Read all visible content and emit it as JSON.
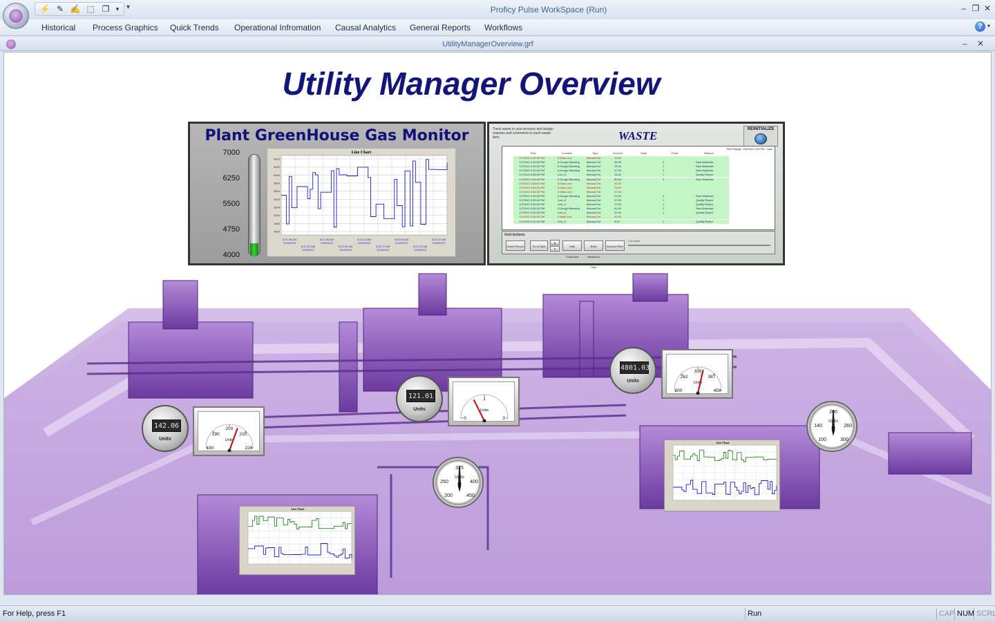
{
  "window": {
    "title": "Proficy Pulse WorkSpace (Run)",
    "minimize": "‒",
    "restore": "❐",
    "close": "✕"
  },
  "quick_access": {
    "icons": [
      "run-icon",
      "edit-icon",
      "draw-icon",
      "select-icon",
      "window-icon"
    ],
    "glyphs": [
      "⚡",
      "✎",
      "✍",
      "⬚",
      "❐"
    ],
    "dropdown": "▾",
    "customize": "▾"
  },
  "menu": {
    "items": [
      "Historical",
      "Process Graphics",
      "Quick Trends",
      "Operational Infromation",
      "Causal Analytics",
      "General Reports",
      "Workflows"
    ],
    "help": "?",
    "help_dropdown": "▾"
  },
  "document": {
    "title": "UtilityManagerOverview.grf",
    "minimize": "‒",
    "close": "✕"
  },
  "canvas": {
    "title": "Utility Manager Overview"
  },
  "ghg_monitor": {
    "title": "Plant GreenHouse Gas Monitor",
    "scale_labels": [
      "7000",
      "6250",
      "5500",
      "4750",
      "4000"
    ],
    "scale_min": 4000,
    "scale_max": 7000,
    "level_value": 4400,
    "fill_color": "#3ad43a",
    "chart_title": "Line Chart",
    "chart_y_labels": [
      "6400",
      "6200",
      "6000",
      "5800",
      "5600",
      "5400",
      "5200",
      "5000",
      "4800",
      "4600"
    ],
    "chart_x_labels": [
      "6:21:45 AM",
      "6:21:58 AM",
      "6:22:11 AM",
      "6:22:24 AM",
      "6:22:37 AM"
    ],
    "chart_x_labels2": [
      "6:21:51 AM",
      "6:22:04 AM",
      "6:22:17 AM",
      "6:22:31 AM"
    ],
    "chart_date": "3/16/2015",
    "series_color": "#1a1ad6"
  },
  "waste": {
    "title": "WASTE",
    "description": "Track waste in your process and assign reasons and comments to each waste item.",
    "reinitialize_label": "REINITIALIZE",
    "time_range": "Time Range:  1/6/2010 4:25 PM - Now",
    "columns": [
      "Time",
      "Location",
      "Type",
      "Amount",
      "Units",
      "Fault",
      "Reason"
    ],
    "rows": [
      {
        "time": "1/7/2010 4:25:00 PM",
        "location": "6 Main Line",
        "type": "Manual Ent",
        "amount": "10.00",
        "units": "",
        "fault": "",
        "reason": "",
        "red": true
      },
      {
        "time": "1/7/2010 4:20:00 PM",
        "location": "6 Dough Blending",
        "type": "Manual Ent",
        "amount": "39.00",
        "units": "",
        "fault": "2",
        "reason": "Raw Materials",
        "red": false
      },
      {
        "time": "1/7/2010 4:15:00 PM",
        "location": "6 Dough Blending",
        "type": "Manual Ent",
        "amount": "13.00",
        "units": "",
        "fault": "2",
        "reason": "Raw Materials",
        "red": false
      },
      {
        "time": "1/7/2010 4:10:00 PM",
        "location": "6 Dough Blending",
        "type": "Manual Ent",
        "amount": "47.00",
        "units": "",
        "fault": "2",
        "reason": "Raw Materials",
        "red": false
      },
      {
        "time": "1/7/2010 4:05:00 PM",
        "location": "Line_6",
        "type": "Manual Ent",
        "amount": "14.00",
        "units": "",
        "fault": "1",
        "reason": "Quality Reject",
        "red": false
      },
      {
        "time": "1/7/2010 4:00:00 PM",
        "location": "6 Dough Blending",
        "type": "Manual Ent",
        "amount": "59.00",
        "units": "",
        "fault": "2",
        "reason": "Raw Materials",
        "red": false
      },
      {
        "time": "1/7/2010 3:55:00 PM",
        "location": "6 Main Line",
        "type": "Manual Ent",
        "amount": "42.00",
        "units": "",
        "fault": "",
        "reason": "",
        "red": true
      },
      {
        "time": "1/7/2010 3:50:00 PM",
        "location": "6 Main Line",
        "type": "Manual Ent",
        "amount": "73.00",
        "units": "",
        "fault": "",
        "reason": "",
        "red": true
      },
      {
        "time": "1/7/2010 3:45:00 PM",
        "location": "6 Main Line",
        "type": "Manual Ent",
        "amount": "47.00",
        "units": "",
        "fault": "",
        "reason": "",
        "red": true
      },
      {
        "time": "1/7/2010 3:40:00 PM",
        "location": "6 Dough Blending",
        "type": "Manual Ent",
        "amount": "21.00",
        "units": "",
        "fault": "2",
        "reason": "Raw Materials",
        "red": false
      },
      {
        "time": "1/7/2010 3:35:00 PM",
        "location": "Line_6",
        "type": "Manual Ent",
        "amount": "47.00",
        "units": "",
        "fault": "1",
        "reason": "Quality Reject",
        "red": false
      },
      {
        "time": "1/7/2010 3:30:00 PM",
        "location": "Line_6",
        "type": "Manual Ent",
        "amount": "17.00",
        "units": "",
        "fault": "1",
        "reason": "Quality Reject",
        "red": false
      },
      {
        "time": "1/7/2010 3:25:00 PM",
        "location": "6 Dough Blending",
        "type": "Manual Ent",
        "amount": "61.00",
        "units": "",
        "fault": "2",
        "reason": "Raw Materials",
        "red": false
      },
      {
        "time": "1/7/2010 3:20:00 PM",
        "location": "Line_6",
        "type": "Manual Ent",
        "amount": "22.00",
        "units": "",
        "fault": "1",
        "reason": "Quality Reject",
        "red": false
      },
      {
        "time": "1/7/2010 3:15:00 PM",
        "location": "6 Main Line",
        "type": "Manual Ent",
        "amount": "40.00",
        "units": "",
        "fault": "",
        "reason": "",
        "red": true
      },
      {
        "time": "1/7/2010 3:10:00 PM",
        "location": "Line_6",
        "type": "Manual Ent",
        "amount": "5.00",
        "units": "",
        "fault": "1",
        "reason": "Quality Reject",
        "red": false
      }
    ],
    "grid_actions_label": "Grid Actions",
    "buttons": [
      "Insert Record",
      "Go to Date",
      "Hide Confirmed",
      "Build Advanced Filter",
      "Amount Filter"
    ],
    "nav_up": "▲",
    "nav_down": "▼",
    "slider_label": "1 or more"
  },
  "instruments": {
    "digital": [
      {
        "value": "142.06",
        "units": "Units"
      },
      {
        "value": "121.01",
        "units": "Units"
      },
      {
        "value": "4801.03",
        "units": "Units"
      }
    ],
    "analog": [
      {
        "ticks": [
          "180",
          "190",
          "200",
          "210",
          "220"
        ],
        "units": "Units",
        "value": 205,
        "min": 180,
        "max": 220
      },
      {
        "ticks": [
          "0",
          "1",
          "3"
        ],
        "units": "Units",
        "value": 1,
        "min": 0,
        "max": 3
      },
      {
        "ticks": [
          "200",
          "262",
          "335",
          "387",
          "450"
        ],
        "units": "Units",
        "value": 345,
        "min": 200,
        "max": 450
      }
    ],
    "round": [
      {
        "ticks": [
          "250",
          "325",
          "400",
          "450",
          "200"
        ],
        "units": "Units",
        "value": 325
      },
      {
        "ticks": [
          "140",
          "200",
          "260",
          "300",
          "100"
        ],
        "units": "Units",
        "value": 200
      }
    ],
    "needle_color": "#c21a1a",
    "mini_chart_title": "Line Chart",
    "green_color": "#1e8a1e",
    "blue_color": "#1a1ad6"
  },
  "status": {
    "help": "For Help, press F1",
    "mode": "Run",
    "cap": "CAP",
    "num": "NUM",
    "scrl": "SCRL"
  }
}
